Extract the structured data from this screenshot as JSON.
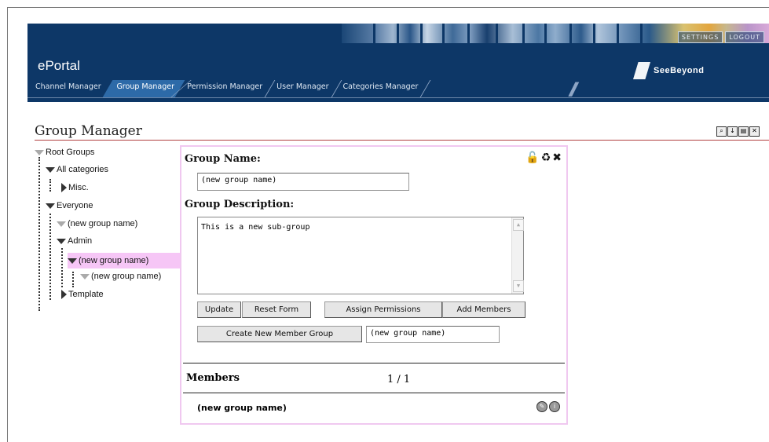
{
  "app": {
    "brand": "ePortal",
    "logo_text": "SeeBeyond",
    "top_links": [
      "SETTINGS",
      "LOGOUT"
    ]
  },
  "tabs": [
    {
      "label": "Channel Manager",
      "active": false
    },
    {
      "label": "Group Manager",
      "active": true
    },
    {
      "label": "Permission Manager",
      "active": false
    },
    {
      "label": "User Manager",
      "active": false
    },
    {
      "label": "Categories Manager",
      "active": false
    }
  ],
  "page": {
    "title": "Group Manager",
    "window_controls": [
      "search-icon",
      "minimize-icon",
      "restore-icon",
      "close-icon"
    ]
  },
  "tree": {
    "root": "Root Groups",
    "all_categories": "All categories",
    "misc": "Misc.",
    "everyone": "Everyone",
    "everyone_child": "(new group name)",
    "admin": "Admin",
    "admin_child": "(new group name)",
    "admin_grandchild": "(new group name)",
    "template": "Template"
  },
  "form": {
    "group_name_label": "Group Name:",
    "group_name_value": "(new group name)",
    "group_description_label": "Group Description:",
    "group_description_value": "This is a new sub-group",
    "buttons": {
      "update": "Update",
      "reset": "Reset Form",
      "assign": "Assign Permissions",
      "add_members": "Add Members",
      "create_member_group": "Create New Member Group"
    },
    "new_member_group_value": "(new group name)"
  },
  "members": {
    "label": "Members",
    "page": "1 / 1",
    "rows": [
      {
        "name": "(new group name)"
      }
    ]
  }
}
